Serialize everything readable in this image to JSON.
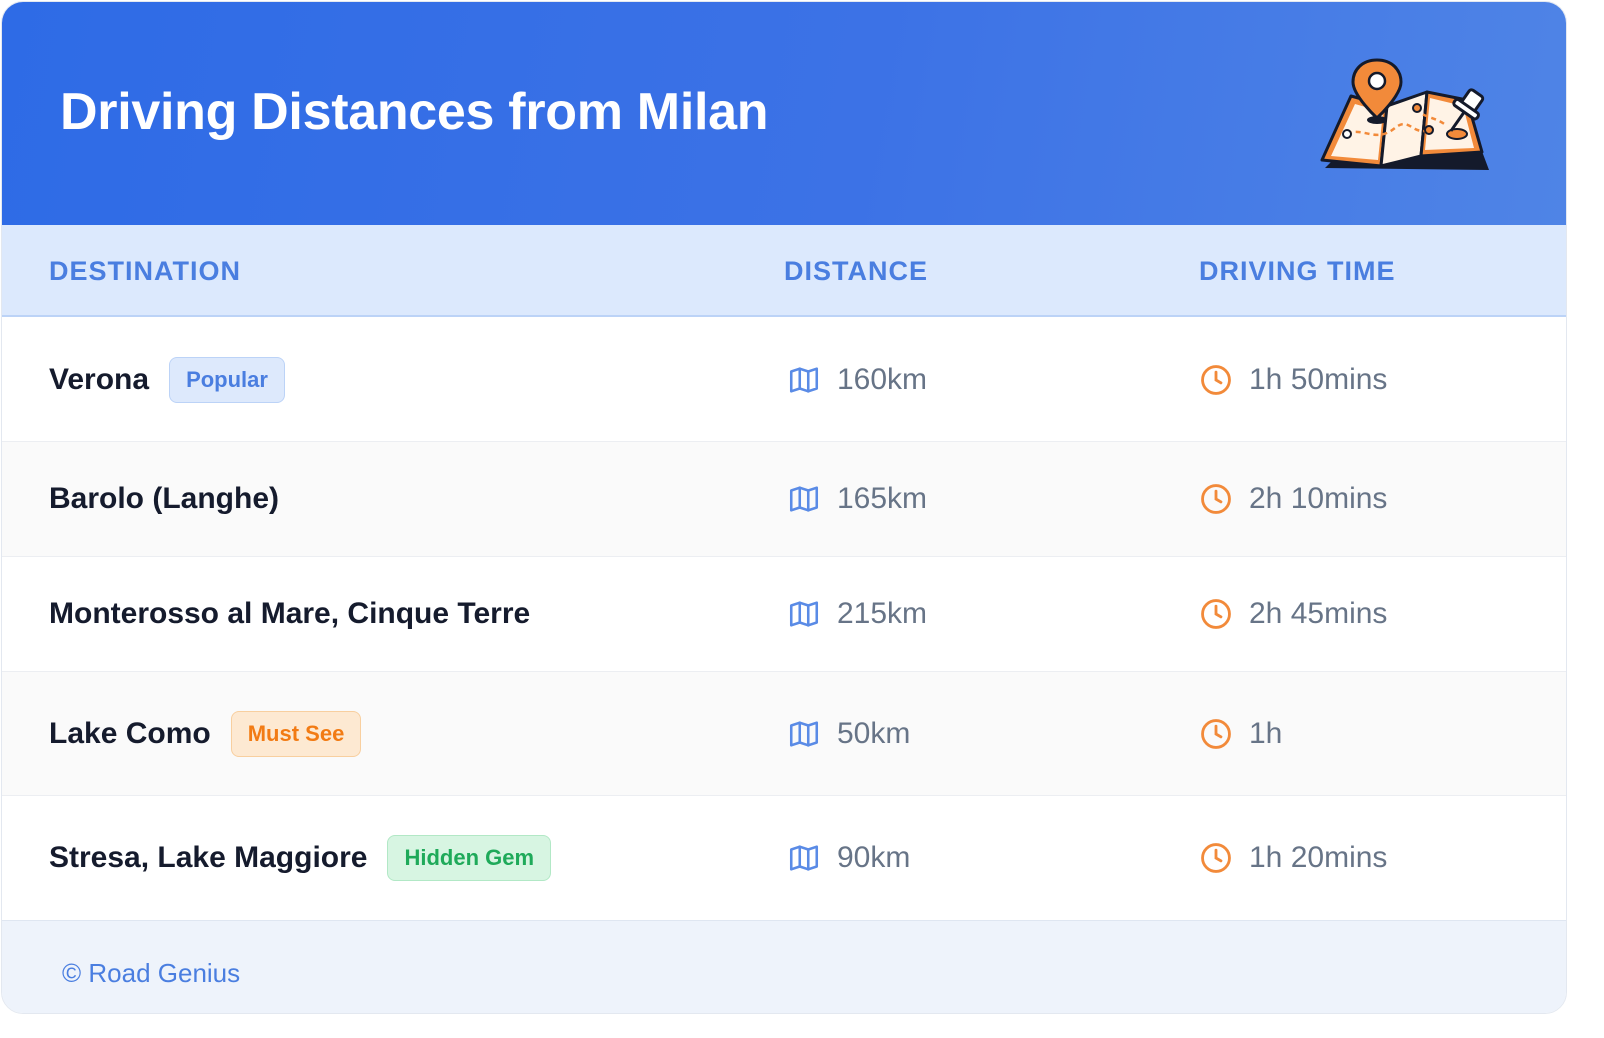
{
  "header": {
    "title": "Driving Distances from Milan",
    "illustration_icon": "folded-map-with-pins-icon"
  },
  "table": {
    "columns": [
      "DESTINATION",
      "DISTANCE",
      "DRIVING TIME"
    ],
    "rows": [
      {
        "destination": "Verona",
        "badge": "Popular",
        "badge_color": "#4a7ee0",
        "distance": "160km",
        "time": "1h 50mins"
      },
      {
        "destination": "Barolo (Langhe)",
        "badge": "",
        "badge_color": "",
        "distance": "165km",
        "time": "2h 10mins"
      },
      {
        "destination": "Monterosso al Mare, Cinque Terre",
        "badge": "",
        "badge_color": "",
        "distance": "215km",
        "time": "2h 45mins"
      },
      {
        "destination": "Lake Como",
        "badge": "Must See",
        "badge_color": "#f27b14",
        "distance": "50km",
        "time": "1h"
      },
      {
        "destination": "Stresa, Lake Maggiore",
        "badge": "Hidden Gem",
        "badge_color": "#1faa5a",
        "distance": "90km",
        "time": "1h 20mins"
      }
    ],
    "distance_icon": "map-icon",
    "time_icon": "clock-icon"
  },
  "footer": {
    "credit": "© Road Genius"
  },
  "colors": {
    "header_gradient_start": "#2e6be6",
    "header_gradient_end": "#4f84e6",
    "accent_blue": "#4a7ee0",
    "accent_orange": "#f27b14",
    "accent_green": "#1faa5a"
  }
}
